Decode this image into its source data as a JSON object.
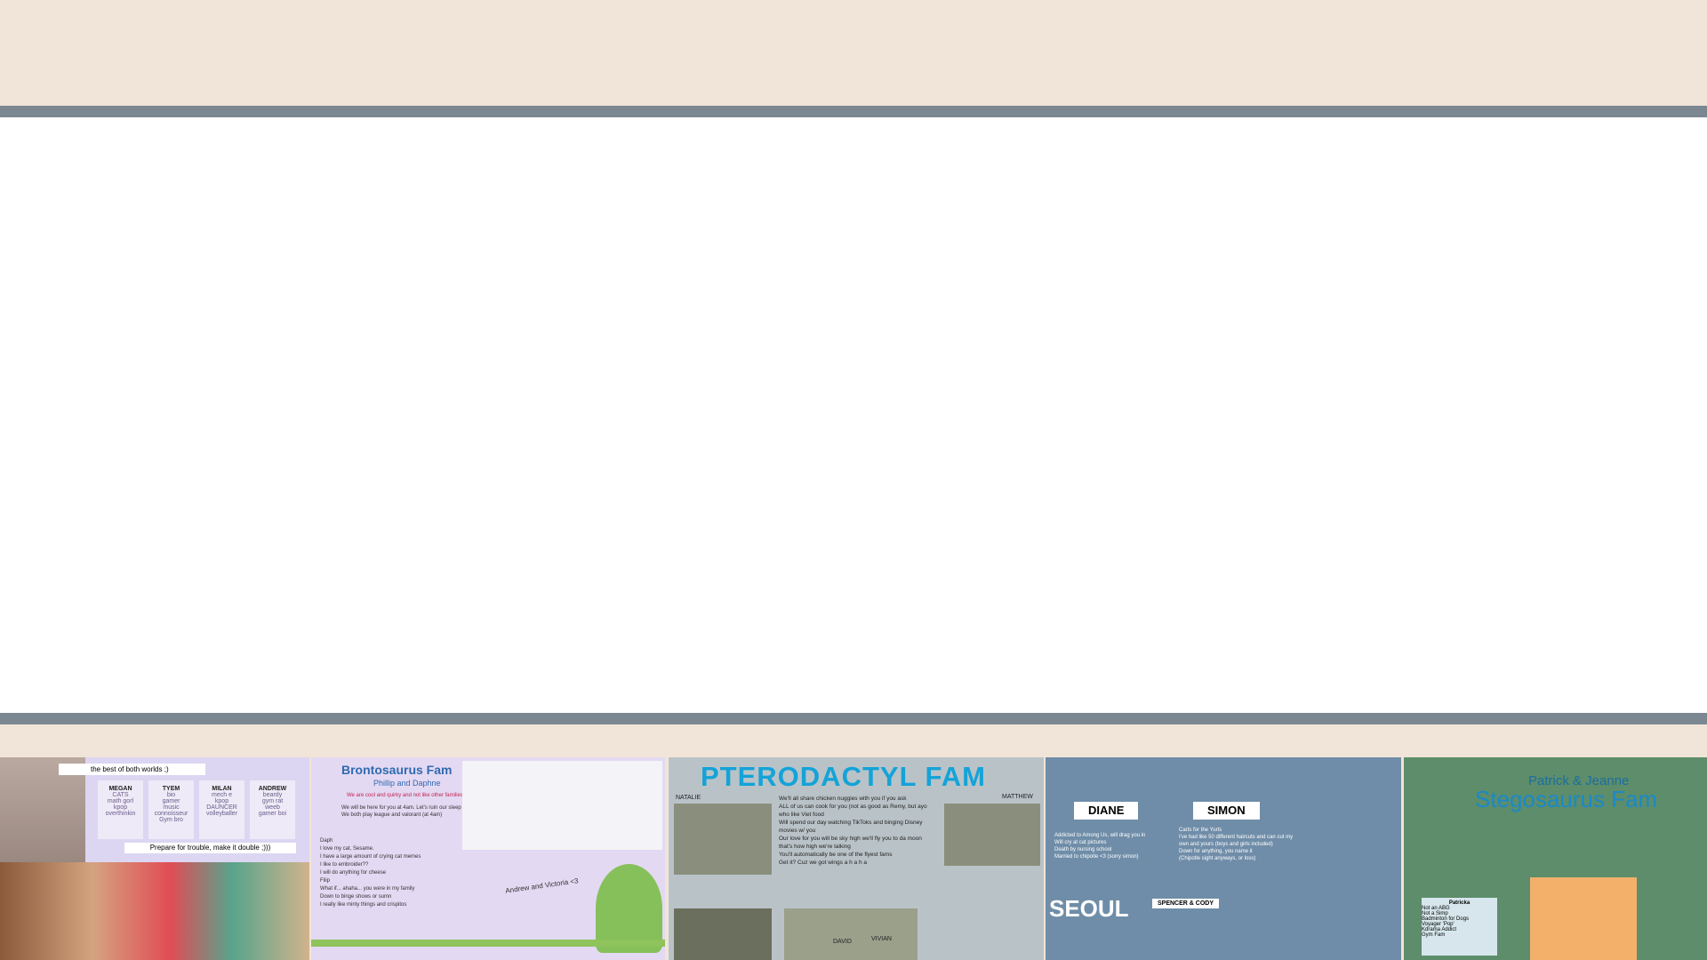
{
  "colors": {
    "background": "#f1e4d8",
    "rule": "#7b8791",
    "content": "#ffffff"
  },
  "slides": [
    {
      "tagline": "the best of both worlds ;)",
      "people": [
        {
          "name": "MEGAN",
          "traits": [
            "CATS",
            "math gorl",
            "kpop",
            "overthinkin"
          ]
        },
        {
          "name": "TYEM",
          "traits": [
            "bio",
            "gamer",
            "music",
            "connoisseur",
            "Gym bro"
          ]
        },
        {
          "name": "MILAN",
          "traits": [
            "mech e",
            "kpop",
            "DAUNCER",
            "volleyballer"
          ]
        },
        {
          "name": "ANDREW",
          "traits": [
            "beardy",
            "gym rat",
            "weeb",
            "gamer boi"
          ]
        }
      ],
      "motto": "Prepare for trouble, make it double ;)))"
    },
    {
      "title": "Brontosaurus Fam",
      "subtitle": "Phillip and Daphne",
      "line1": "We are cool and quirky and not like other families",
      "line2": "We will be here for you at 4am. Let's ruin our sleep schedules together!",
      "line3": "We both play league and valorant (at 4am)",
      "notes": [
        "Daph",
        "I love my cat, Sesame.",
        "I have a large amount of crying cat memes",
        "I like to embroider??",
        "I will do anything for cheese",
        "Filip",
        "What if... ahaha... you were in my family",
        "Down to binge shows or sumn",
        "I really like minty things and crispitos"
      ],
      "caption": "Andrew and Victoria <3"
    },
    {
      "title": "PTERODACTYL FAM",
      "natalie": "NATALIE",
      "matthew": "MATTHEW",
      "david": "DAVID",
      "vivian": "VIVIAN",
      "body": [
        "We'll all share chicken nuggies with you if you ask",
        "ALL of us can cook for you (not as good as Remy, but ayo who like Viet food",
        "Will spend our day watching TikToks and binging Disney movies w/ you",
        "Our love for you will be sky high we'll fly you to da moon that's how high we're talking",
        "You'll automatically be one of the flyest fams",
        "Get it? Cuz we got wings a h a h a"
      ]
    },
    {
      "diane": "DIANE",
      "simon": "SIMON",
      "diane_bio": [
        "Addicted to Among Us, will drag you in",
        "Will cry at cat pictures",
        "Death by nursing school",
        "Married to chipotle <3 (sorry simon)"
      ],
      "simon_bio": [
        "Carts for the Yurts",
        "I've had like 50 different haircuts and can cut my own and yours (boys and girls included)",
        "Down for anything, you name it",
        "(Chipotle sight anyways, or loss)"
      ],
      "seoul": "SEOUL",
      "spencer": "SPENCER & CODY"
    },
    {
      "header": "Patrick & Jeanne",
      "fam": "Stegosaurus Fam",
      "card_title": "Patricka",
      "card_items": [
        "Not an ABG",
        "Not a Simp",
        "Badminton for Dogs",
        "Voyager 'Pop'",
        "Kdrama Addict",
        "Gym Fam"
      ]
    }
  ]
}
